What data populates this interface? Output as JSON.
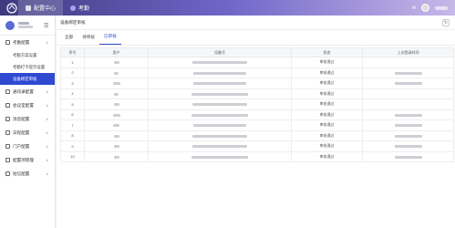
{
  "header": {
    "tabs": [
      {
        "label": "配置中心",
        "active": true
      },
      {
        "label": "考勤",
        "active": false
      }
    ]
  },
  "sidebar": {
    "user_name": "",
    "items": [
      {
        "label": "考勤配置",
        "type": "group"
      },
      {
        "label": "考勤方案设置",
        "type": "sub"
      },
      {
        "label": "考勤打卡提示设置",
        "type": "sub"
      },
      {
        "label": "设备绑定审核",
        "type": "sub",
        "active": true
      },
      {
        "label": "通讯录配置",
        "type": "group"
      },
      {
        "label": "会议室配置",
        "type": "group"
      },
      {
        "label": "消息配置",
        "type": "group"
      },
      {
        "label": "日程配置",
        "type": "group"
      },
      {
        "label": "门户配置",
        "type": "group"
      },
      {
        "label": "配置项管理",
        "type": "group"
      },
      {
        "label": "短信配置",
        "type": "group"
      }
    ]
  },
  "main": {
    "breadcrumb": "设备绑定审核",
    "tabs": [
      {
        "label": "全部"
      },
      {
        "label": "待审核"
      },
      {
        "label": "已审核",
        "active": true
      }
    ],
    "table": {
      "headers": [
        "序号",
        "用户",
        "设备号",
        "状态",
        "上次登录时间"
      ],
      "rows": [
        {
          "no": "1",
          "status": "审核通过",
          "has_time": false
        },
        {
          "no": "2",
          "status": "审核通过",
          "has_time": true
        },
        {
          "no": "3",
          "status": "审核通过",
          "has_time": true
        },
        {
          "no": "4",
          "status": "审核通过",
          "has_time": false
        },
        {
          "no": "5",
          "status": "审核通过",
          "has_time": false
        },
        {
          "no": "6",
          "status": "审核通过",
          "has_time": true
        },
        {
          "no": "7",
          "status": "审核通过",
          "has_time": true
        },
        {
          "no": "8",
          "status": "审核通过",
          "has_time": true
        },
        {
          "no": "9",
          "status": "审核通过",
          "has_time": true
        },
        {
          "no": "10",
          "status": "审核通过",
          "has_time": true
        }
      ]
    }
  },
  "colors": {
    "accent": "#2f4ad0"
  }
}
